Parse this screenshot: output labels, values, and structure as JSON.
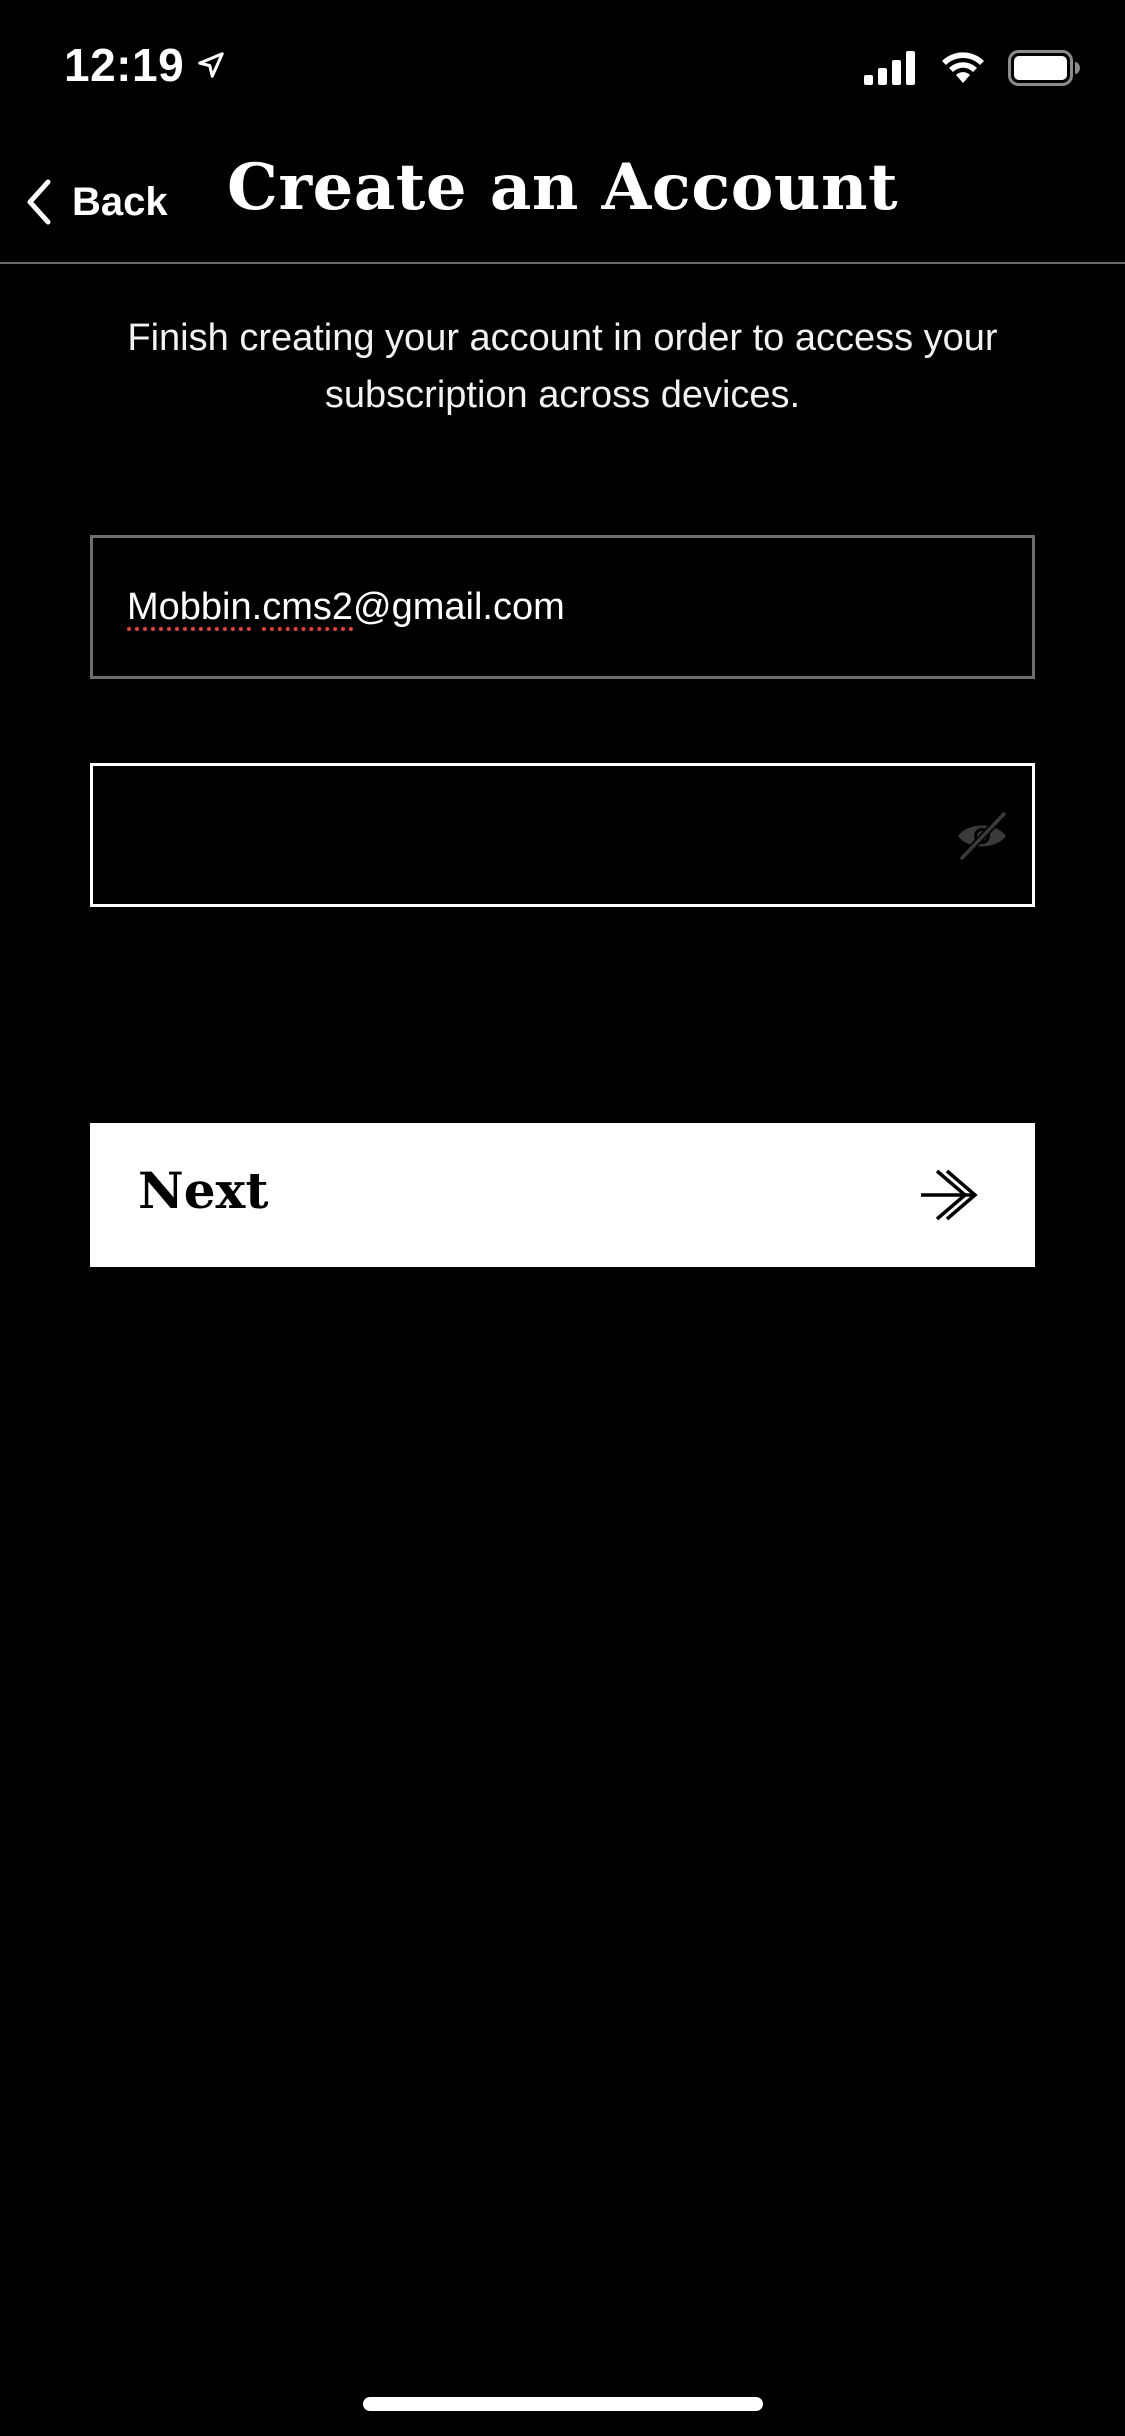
{
  "status_bar": {
    "time": "12:19",
    "icons": [
      "location-arrow-icon",
      "signal-icon",
      "wifi-icon",
      "battery-icon"
    ]
  },
  "nav": {
    "back_label": "Back",
    "title": "Create an Account"
  },
  "subtitle": "Finish creating your account in order to access your subscription across devices.",
  "form": {
    "email_value_misspelled_1": "Mobbin",
    "email_value_dot": ".",
    "email_value_misspelled_2": "cms2",
    "email_value_rest": "@gmail.com",
    "password_value": "",
    "password_toggle_icon": "eye-slash-icon"
  },
  "next_button": {
    "label": "Next",
    "icon": "double-arrow-right-icon"
  },
  "colors": {
    "background": "#000000",
    "text": "#ffffff",
    "button_bg": "#ffffff",
    "button_text": "#000000",
    "field_border_inactive": "#6e6e6e",
    "field_border_active": "#ffffff",
    "spellcheck_underline": "#e0453b"
  }
}
